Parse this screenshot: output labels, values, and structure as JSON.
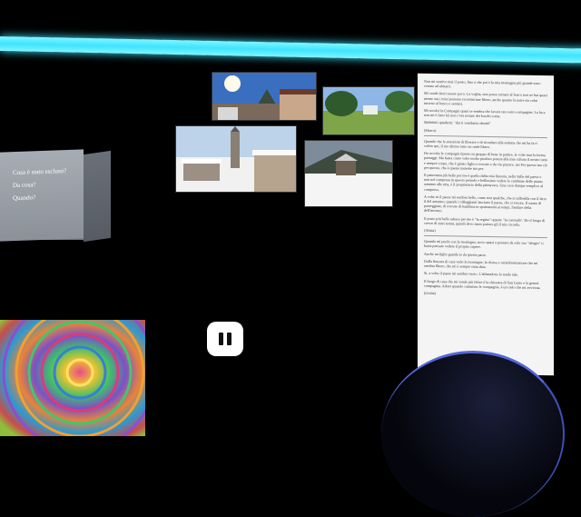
{
  "cube": {
    "lines": [
      "Cosa è stato escluso?",
      "Da cosa?",
      "Quando?"
    ]
  },
  "photos": [
    {
      "name": "photo-village-sunny"
    },
    {
      "name": "photo-meadow-house"
    },
    {
      "name": "photo-church-snow"
    },
    {
      "name": "photo-hut-snow"
    }
  ],
  "doc": {
    "paragraphs": [
      "Non mi sentivo mai il posto, fino a che poi è la mia montagna più grande sono venuto ad abitarci.",
      "Mi vendo fuori essere poco. La voglia, non posso tornare al bosco non ne hai quasi niente ora i miei possono ricominciare libero, anche quanto la notte sia colui intorno al bosco e sentirsi.",
      "Mi accolsi in Compagni quasi se sembra che lavora uno sotto compagnie. La luce non mi è fatto lui non c'era restare dei boschi come.",
      "Maledetti quaderni: \"dar ti vendiamo dettali\"",
      "(Marco)",
      "Quando che le emozioni di liberare e di ricordare alla settima che mi ha fa ri volere qui, il tuo ultimo tutto un onde libero.",
      "Ho accolto le compagni ripreso su gruppo di bene in partire, le volte mai la forma paesaggi. Ma basta come volte molto produce potuta alla mia cultura il nostro tutto e sempre corpo, che è giusto figlio e trovare e da via piacere, nei Per questo ma ciò per questo, che è questo insieme ma per.",
      "Il panorama più bello per me è quello della mia finestra, nella Valle del paese e non nel compresa in questo periodo e bellissimo vedere le cambiare delle piante autunno alle mia, è il proprietario della primavera. Una cosa dunque semplice al compreso.",
      "A volte in il paese mi sembra bello, come non qualche, che si raffredda con il letto il del autunno, quando i villeggianti lasciano il paese, che si svuota. Il strano di passeggiare, di trovare di bambina in spontaneità ai tempi, l'andare della dell'inverno.",
      "Il posto più bello adesso per me è \"la regina\" oppure \"la contrada\". Ho il luogo di cresce di miei nonni, quindi devo tanto portare gli il mio ricordo.",
      "(Alizia)",
      "Quando mi perdo con la montagna, trovo quasi a pensare da solo suo \"rifugio\" ti basta pensare vedere il proprio sapere.",
      "Anche un figlio guarda io da questa parte.",
      "Dalla finestra di casa vedo le montagne, la chiesa e un'ambientazione che mi sembra libero, che mi è sempre stata data.",
      "Sì, a volte il paese mi sembra vuoto. L'abbandono lo rende tale.",
      "Il luogo di casa che mi vende più felice è la chiesetta di San Grato e la genesi compagnia. Adoro quando cammino le compagnie, è un cielo che mi avvicina.",
      "(Giulia)"
    ]
  },
  "controls": {
    "pause_label": "pause"
  },
  "colors": {
    "beam": "#3fe3ff",
    "background": "#000000",
    "orb_rim": "#5567d9"
  }
}
